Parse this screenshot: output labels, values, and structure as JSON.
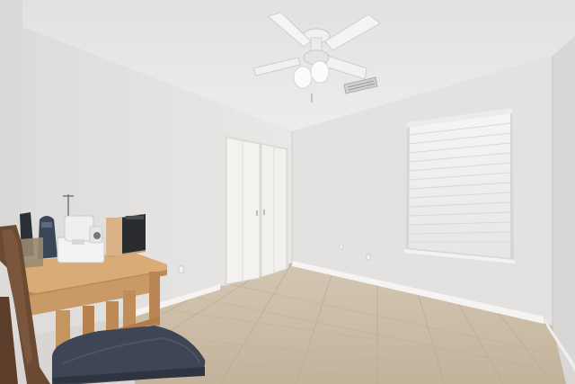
{
  "scene": {
    "description_free": true,
    "colors": {
      "ceiling": "#e9e8e6",
      "left_wall": "#e6e5e3",
      "back_wall": "#e3e2e0",
      "right_wall": "#dcdad8",
      "floor": "#cbbda8",
      "grout": "#bcae98",
      "baseboard": "#f4f3f1",
      "door": "#f3f2ef",
      "blind": "#f1f0ee",
      "fan": "#f4f4f2",
      "desk": "#cf9f6c",
      "desk_dark": "#b48152",
      "chair_seat": "#3e4554",
      "chair_frame": "#6b4a34"
    },
    "objects": [
      "ceiling-fan",
      "air-vent",
      "closet-doors",
      "window-blinds",
      "wooden-desk",
      "sewing-machine",
      "coffee-maker",
      "chair",
      "electrical-outlet"
    ]
  }
}
